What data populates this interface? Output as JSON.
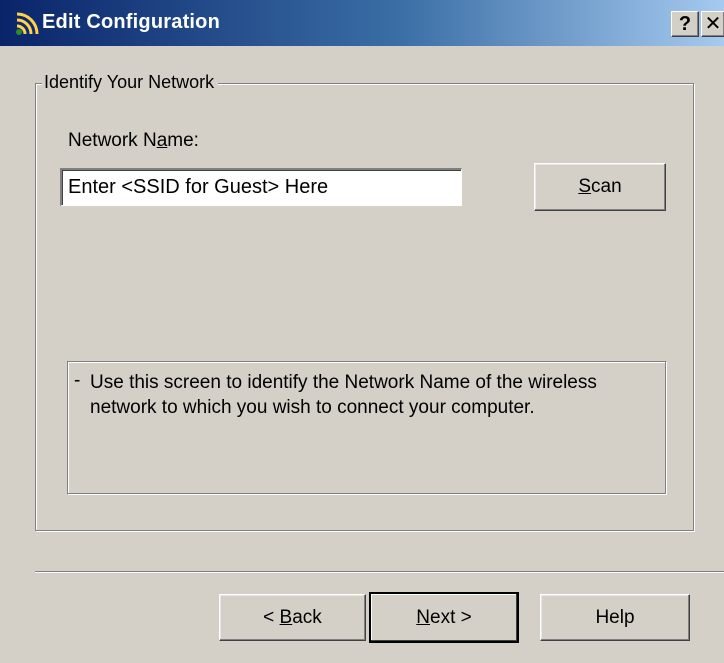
{
  "window": {
    "title": "Edit Configuration",
    "help_button": "?",
    "close_button": "✕"
  },
  "group": {
    "legend": "Identify Your Network"
  },
  "network_name": {
    "label_pre": "Network N",
    "label_mnemonic": "a",
    "label_post": "me:",
    "value": "Enter <SSID for Guest> Here"
  },
  "scan_button": {
    "mnemonic": "S",
    "rest": "can"
  },
  "info": {
    "bullet": "-",
    "text": "Use this screen to identify the Network Name of the wireless network to which you wish to connect your computer."
  },
  "buttons": {
    "back_prefix": "< ",
    "back_mnemonic": "B",
    "back_rest": "ack",
    "next_mnemonic": "N",
    "next_rest": "ext >",
    "help": "Help"
  },
  "colors": {
    "titlebar_start": "#0a246a",
    "titlebar_end": "#a6caf0",
    "dialog_bg": "#d4d0c8"
  },
  "icons": {
    "title_icon": "wireless-signal-icon"
  }
}
